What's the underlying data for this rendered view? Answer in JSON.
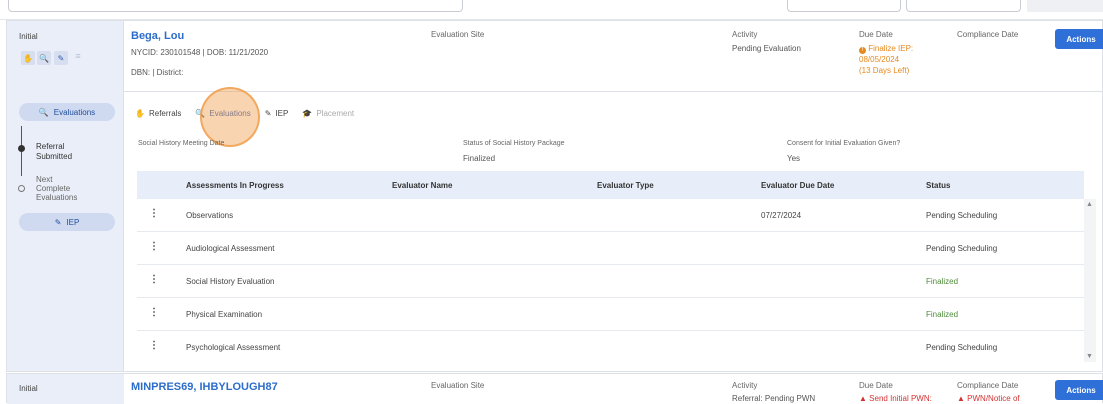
{
  "student1": {
    "stage": "Initial",
    "name": "Bega, Lou",
    "ids": "NYCID: 230101548 | DOB: 11/21/2020",
    "dbn": "DBN: | District:",
    "eval_site_label": "Evaluation Site",
    "activity_label": "Activity",
    "activity_value": "Pending Evaluation",
    "due_label": "Due Date",
    "due_value_line1": "Finalize IEP:",
    "due_value_line2": "08/05/2024",
    "due_value_line3": "(13 Days Left)",
    "compliance_label": "Compliance Date",
    "actions_label": "Actions"
  },
  "side": {
    "evaluations_pill": "Evaluations",
    "step1_line1": "Referral",
    "step1_line2": "Submitted",
    "step2_line1": "Next",
    "step2_line2": "Complete",
    "step2_line3": "Evaluations",
    "iep_pill": "IEP"
  },
  "tabs": {
    "referrals": "Referrals",
    "evaluations": "Evaluations",
    "iep": "IEP",
    "placement": "Placement"
  },
  "info": {
    "social_history_label": "Social History Meeting Date",
    "status_pkg_label": "Status of Social History Package",
    "status_pkg_value": "Finalized",
    "consent_label": "Consent for Initial Evaluation Given?",
    "consent_value": "Yes"
  },
  "table": {
    "headers": [
      "Assessments In Progress",
      "Evaluator Name",
      "Evaluator Type",
      "Evaluator Due Date",
      "Status"
    ],
    "rows": [
      {
        "assessment": "Observations",
        "name": "",
        "type": "",
        "due": "07/27/2024",
        "status": "Pending Scheduling"
      },
      {
        "assessment": "Audiological Assessment",
        "name": "",
        "type": "",
        "due": "",
        "status": "Pending Scheduling"
      },
      {
        "assessment": "Social History Evaluation",
        "name": "",
        "type": "",
        "due": "",
        "status": "Finalized"
      },
      {
        "assessment": "Physical Examination",
        "name": "",
        "type": "",
        "due": "",
        "status": "Finalized"
      },
      {
        "assessment": "Psychological Assessment",
        "name": "",
        "type": "",
        "due": "",
        "status": "Pending Scheduling"
      }
    ]
  },
  "student2": {
    "stage": "Initial",
    "name": "MINPRES69, IHBYLOUGH87",
    "eval_site_label": "Evaluation Site",
    "activity_label": "Activity",
    "activity_value": "Referral: Pending PWN",
    "due_label": "Due Date",
    "due_value": "Send Initial PWN:",
    "compliance_label": "Compliance Date",
    "compliance_value": "PWN/Notice of",
    "actions_label": "Actions"
  },
  "colors": {
    "accent": "#2e6fd8",
    "finalized": "#4f8c3a",
    "due": "#e58a1f",
    "alert": "#d43232"
  }
}
